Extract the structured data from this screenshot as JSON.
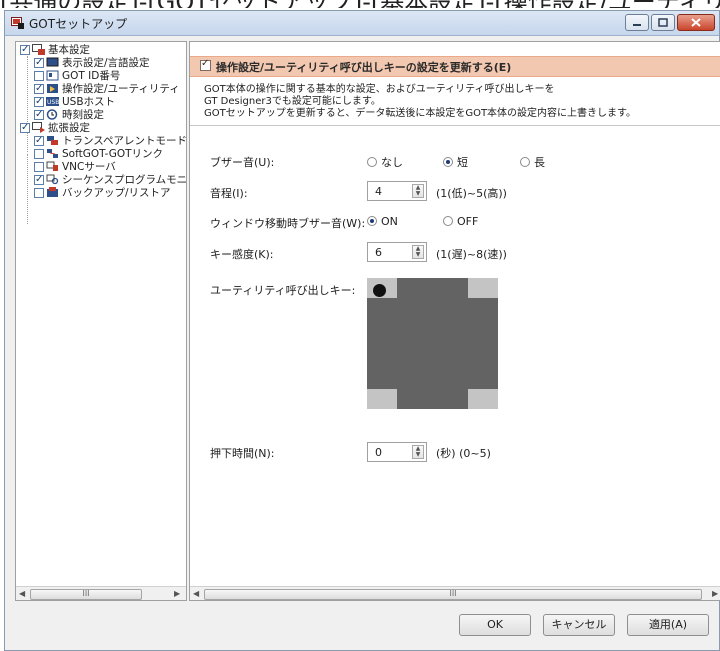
{
  "caption": "[共通の設定]-[GOTセットアップ]-[基本設定]-[操作設定/ユーティリティ...",
  "window": {
    "title": "GOTセットアップ"
  },
  "tree": {
    "root_basic": "基本設定",
    "basic_items": [
      "表示設定/言語設定",
      "GOT ID番号",
      "操作設定/ユーティリティ",
      "USBホスト",
      "時刻設定"
    ],
    "root_ext": "拡張設定",
    "ext_items": [
      "トランスペアレントモード設",
      "SoftGOT-GOTリンク",
      "VNCサーバ",
      "シーケンスプログラムモニ",
      "バックアップ/リストア"
    ],
    "scroll_thumb": "III"
  },
  "panel": {
    "header": "操作設定/ユーティリティ呼び出しキーの設定を更新する(E)",
    "desc_lines": [
      "GOT本体の操作に関する基本的な設定、およびユーティリティ呼び出しキーを",
      "GT Designer3でも設定可能にします。",
      "GOTセットアップを更新すると、データ転送後に本設定をGOT本体の設定内容に上書きします。"
    ],
    "buzzer": {
      "label": "ブザー音(U):",
      "options": [
        "なし",
        "短",
        "長"
      ],
      "selected": "短"
    },
    "tone": {
      "label": "音程(I):",
      "value": "4",
      "range": "(1(低)~5(高))"
    },
    "window_buzzer": {
      "label": "ウィンドウ移動時ブザー音(W):",
      "options": [
        "ON",
        "OFF"
      ],
      "selected": "ON"
    },
    "sensitivity": {
      "label": "キー感度(K):",
      "value": "6",
      "range": "(1(遅)~8(速))"
    },
    "utility_key": {
      "label": "ユーティリティ呼び出しキー:"
    },
    "press_time": {
      "label": "押下時間(N):",
      "value": "0",
      "range": "(秒) (0~5)"
    },
    "scroll_thumb": "III"
  },
  "buttons": {
    "ok": "OK",
    "cancel": "キャンセル",
    "apply": "適用(A)"
  },
  "colors": {
    "header_bg": "#f3c8b0",
    "keymap_bg": "#636363",
    "keymap_corner": "#c4c4c4"
  }
}
